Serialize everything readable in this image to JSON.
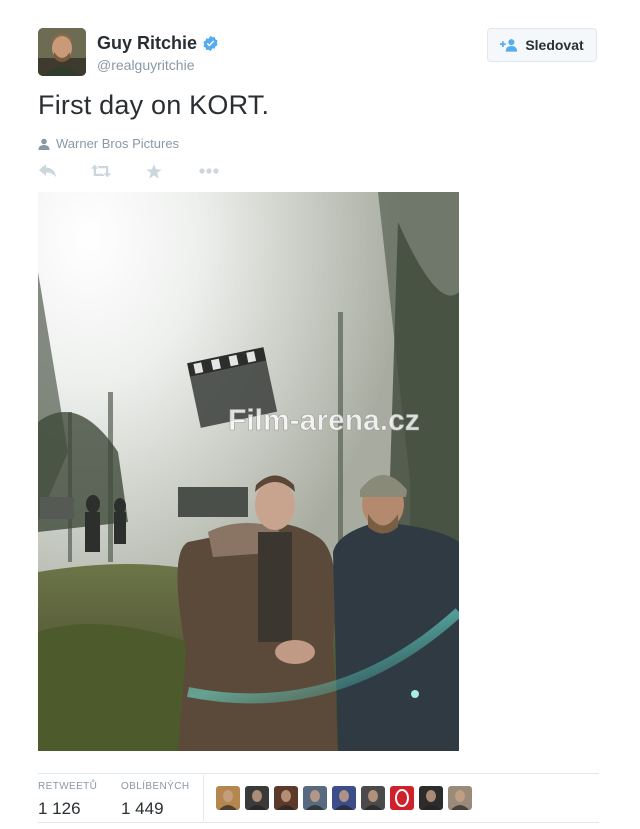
{
  "tweet": {
    "author_name": "Guy Ritchie",
    "handle": "@realguyritchie",
    "verified_icon": "verified-badge-icon",
    "text": "First day on KORT.",
    "tagged": "Warner Bros Pictures",
    "photo_watermark": "Film-arena.cz"
  },
  "follow_button": {
    "label": "Sledovat",
    "icon": "add-user-icon"
  },
  "actions": [
    "reply-icon",
    "retweet-icon",
    "favorite-icon",
    "more-icon"
  ],
  "stats": {
    "retweets_label": "RETWEETŮ",
    "retweets_value": "1 126",
    "favorites_label": "OBLÍBENÝCH",
    "favorites_value": "1 449"
  },
  "likers": [
    {
      "name": "liker-avatar-1",
      "color": "#b4874f"
    },
    {
      "name": "liker-avatar-2",
      "color": "#3a3a3a"
    },
    {
      "name": "liker-avatar-3",
      "color": "#5b3a2a"
    },
    {
      "name": "liker-avatar-4",
      "color": "#586a80"
    },
    {
      "name": "liker-avatar-5",
      "color": "#3c4d8a"
    },
    {
      "name": "liker-avatar-6",
      "color": "#4a4a4a"
    },
    {
      "name": "liker-avatar-7",
      "color": "#d0202a"
    },
    {
      "name": "liker-avatar-8",
      "color": "#2c2c2c"
    },
    {
      "name": "liker-avatar-9",
      "color": "#9a8a7a"
    }
  ],
  "colors": {
    "text": "#292f33",
    "muted": "#8899a6",
    "verified": "#55acee",
    "border": "#e1e8ed",
    "action_icon": "#ccd6dd"
  }
}
